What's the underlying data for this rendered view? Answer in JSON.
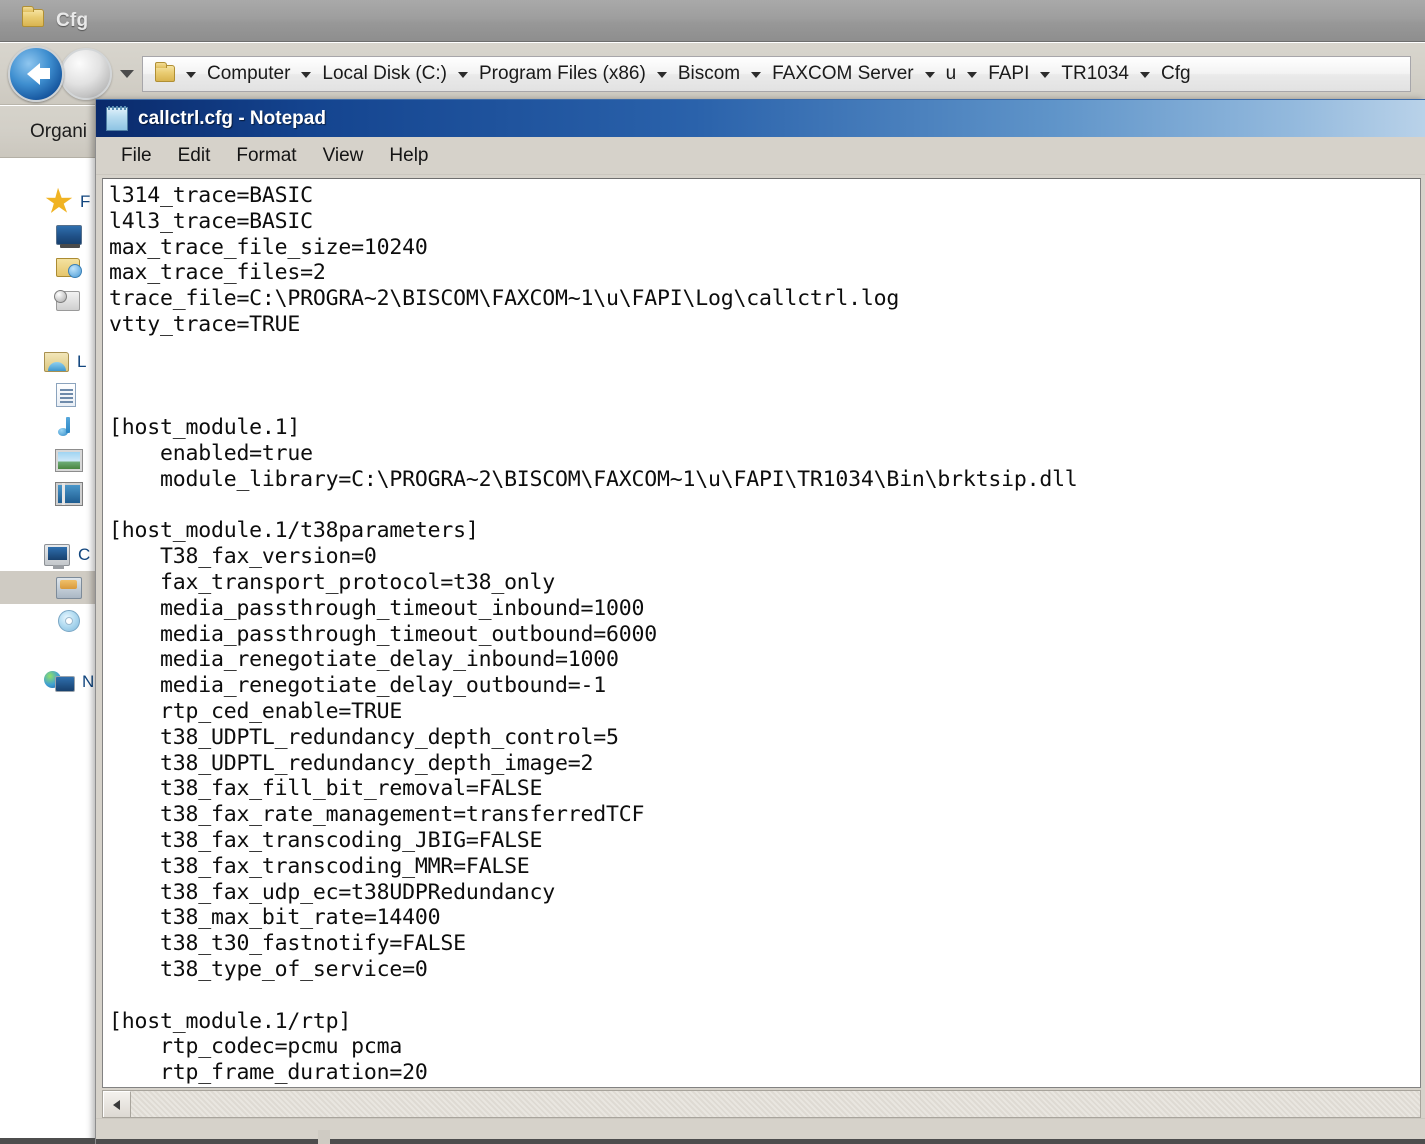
{
  "explorer": {
    "title": "Cfg",
    "window_icon": "folder-icon",
    "nav": {
      "back_icon": "back-arrow-icon",
      "forward_icon": "forward-arrow-icon",
      "recent_pages_icon": "chevron-down-icon",
      "address_folder_icon": "folder-icon",
      "breadcrumbs": [
        "Computer",
        "Local Disk (C:)",
        "Program Files (x86)",
        "Biscom",
        "FAXCOM Server",
        "u",
        "FAPI",
        "TR1034",
        "Cfg"
      ]
    },
    "commandbar": {
      "organize_label": "Organi"
    },
    "nav_pane": {
      "groups": [
        {
          "label": "F",
          "icon": "favorites-star-icon",
          "items": [
            {
              "label": "",
              "icon": "desktop-icon"
            },
            {
              "label": "",
              "icon": "downloads-icon"
            },
            {
              "label": "",
              "icon": "recent-places-icon"
            }
          ]
        },
        {
          "label": "L",
          "icon": "libraries-icon",
          "items": [
            {
              "label": "",
              "icon": "documents-icon"
            },
            {
              "label": "",
              "icon": "music-icon"
            },
            {
              "label": "",
              "icon": "pictures-icon"
            },
            {
              "label": "",
              "icon": "videos-icon"
            }
          ]
        },
        {
          "label": "C",
          "icon": "computer-icon",
          "items": [
            {
              "label": "",
              "icon": "local-disk-icon",
              "selected": true
            },
            {
              "label": "",
              "icon": "dvd-drive-icon"
            }
          ]
        },
        {
          "label": "N",
          "icon": "network-icon",
          "items": []
        }
      ]
    }
  },
  "notepad": {
    "title": "callctrl.cfg - Notepad",
    "icon": "notepad-icon",
    "menu": [
      "File",
      "Edit",
      "Format",
      "View",
      "Help"
    ],
    "scrollbar": {
      "left_arrow_icon": "arrow-left-icon"
    },
    "content": "l314_trace=BASIC\nl4l3_trace=BASIC\nmax_trace_file_size=10240\nmax_trace_files=2\ntrace_file=C:\\PROGRA~2\\BISCOM\\FAXCOM~1\\u\\FAPI\\Log\\callctrl.log\nvtty_trace=TRUE\n\n\n\n[host_module.1]\n    enabled=true\n    module_library=C:\\PROGRA~2\\BISCOM\\FAXCOM~1\\u\\FAPI\\TR1034\\Bin\\brktsip.dll\n\n[host_module.1/t38parameters]\n    T38_fax_version=0\n    fax_transport_protocol=t38_only\n    media_passthrough_timeout_inbound=1000\n    media_passthrough_timeout_outbound=6000\n    media_renegotiate_delay_inbound=1000\n    media_renegotiate_delay_outbound=-1\n    rtp_ced_enable=TRUE\n    t38_UDPTL_redundancy_depth_control=5\n    t38_UDPTL_redundancy_depth_image=2\n    t38_fax_fill_bit_removal=FALSE\n    t38_fax_rate_management=transferredTCF\n    t38_fax_transcoding_JBIG=FALSE\n    t38_fax_transcoding_MMR=FALSE\n    t38_fax_udp_ec=t38UDPRedundancy\n    t38_max_bit_rate=14400\n    t38_t30_fastnotify=FALSE\n    t38_type_of_service=0\n\n[host_module.1/rtp]\n    rtp_codec=pcmu pcma\n    rtp_frame_duration=20"
  },
  "colors": {
    "titlebar_blue_dark": "#0a2a6b",
    "titlebar_blue_light": "#b9d2e9",
    "explorer_chrome": "#d6d2ca",
    "selected_row": "#cfcbc3",
    "link_text": "#11457e"
  }
}
